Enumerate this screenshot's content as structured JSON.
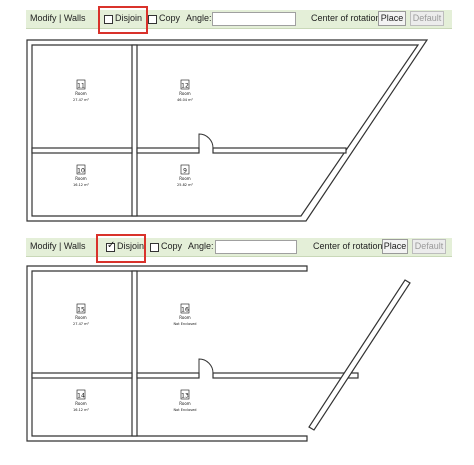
{
  "top": {
    "toolbar": {
      "title": "Modify | Walls",
      "disjoin_label": "Disjoin",
      "disjoin_checked": false,
      "copy_label": "Copy",
      "angle_label": "Angle:",
      "angle_value": "",
      "center_label": "Center of rotation:",
      "place_label": "Place",
      "default_label": "Default"
    },
    "rooms": [
      {
        "number": "11",
        "name": "Room",
        "area": "27.47 m²"
      },
      {
        "number": "12",
        "name": "Room",
        "area": "46.04 m²"
      },
      {
        "number": "10",
        "name": "Room",
        "area": "16.12 m²"
      },
      {
        "number": "9",
        "name": "Room",
        "area": "25.82 m²"
      }
    ]
  },
  "bottom": {
    "toolbar": {
      "title": "Modify | Walls",
      "disjoin_label": "Disjoin",
      "disjoin_checked": true,
      "copy_label": "Copy",
      "angle_label": "Angle:",
      "angle_value": "",
      "center_label": "Center of rotation:",
      "place_label": "Place",
      "default_label": "Default"
    },
    "rooms": [
      {
        "number": "15",
        "name": "Room",
        "area": "27.47 m²"
      },
      {
        "number": "16",
        "name": "Room",
        "area": "Not Enclosed"
      },
      {
        "number": "14",
        "name": "Room",
        "area": "16.12 m²"
      },
      {
        "number": "13",
        "name": "Room",
        "area": "Not Enclosed"
      }
    ]
  },
  "colors": {
    "toolbar_bg": "#e4efd8",
    "highlight": "#d9322b",
    "wall_fill": "#ffffff",
    "wall_stroke": "#333333"
  }
}
